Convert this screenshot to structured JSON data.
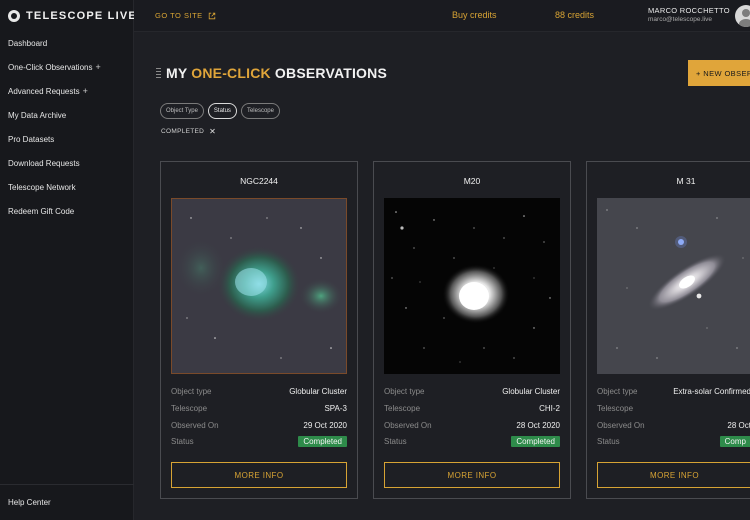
{
  "brand": {
    "name": "TELESCOPE LIVE"
  },
  "sidebar": {
    "items": [
      {
        "label": "Dashboard",
        "plus": ""
      },
      {
        "label": "One-Click Observations",
        "plus": "+"
      },
      {
        "label": "Advanced Requests",
        "plus": "+"
      },
      {
        "label": "My Data Archive",
        "plus": ""
      },
      {
        "label": "Pro Datasets",
        "plus": ""
      },
      {
        "label": "Download Requests",
        "plus": ""
      },
      {
        "label": "Telescope Network",
        "plus": ""
      },
      {
        "label": "Redeem Gift Code",
        "plus": ""
      }
    ],
    "help": "Help Center"
  },
  "topbar": {
    "goto": "GO TO SITE",
    "buy": "Buy credits",
    "credits": "88 credits",
    "user_name": "MARCO ROCCHETTO",
    "user_email": "marco@telescope.live"
  },
  "main": {
    "title_pre": "MY ",
    "title_accent": "ONE-CLICK",
    "title_post": " OBSERVATIONS",
    "new_button": "+ NEW OBSERVATION",
    "filters": [
      "Object Type",
      "Status",
      "Telescope"
    ],
    "active_filter": "COMPLETED",
    "active_filter_remove": "✕"
  },
  "labels": {
    "object_type": "Object type",
    "telescope": "Telescope",
    "observed_on": "Observed On",
    "status": "Status",
    "more_info": "MORE INFO"
  },
  "cards": [
    {
      "title": "NGC2244",
      "object_type": "Globular Cluster",
      "telescope": "SPA-3",
      "observed_on": "29 Oct 2020",
      "status": "Completed"
    },
    {
      "title": "M20",
      "object_type": "Globular Cluster",
      "telescope": "CHI-2",
      "observed_on": "28 Oct 2020",
      "status": "Completed"
    },
    {
      "title": "M 31",
      "object_type": "Extra-solar Confirmed",
      "telescope": "",
      "observed_on": "28 Oct",
      "status": "Comp"
    }
  ],
  "colors": {
    "accent": "#e0a53a",
    "status_green": "#2e8b4a"
  },
  "icons": {
    "external": "external-link-icon",
    "menu": "hamburger-menu-icon",
    "remove": "close-icon"
  }
}
